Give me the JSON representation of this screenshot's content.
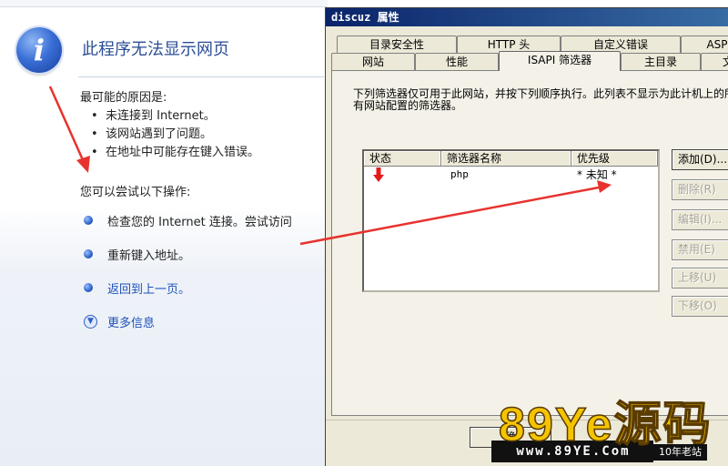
{
  "browser_page": {
    "title": "此程序无法显示网页",
    "causes_heading": "最可能的原因是:",
    "causes": [
      "未连接到 Internet。",
      "该网站遇到了问题。",
      "在地址中可能存在键入错误。"
    ],
    "try_heading": "您可以尝试以下操作:",
    "actions": [
      "检查您的 Internet 连接。尝试访问",
      "重新键入地址。",
      "返回到上一页。",
      "更多信息"
    ]
  },
  "dialog": {
    "title": "discuz 属性",
    "tabs_row1": [
      "目录安全性",
      "HTTP 头",
      "自定义错误",
      "ASP"
    ],
    "tabs_row2": [
      "网站",
      "性能",
      "ISAPI 筛选器",
      "主目录",
      "文"
    ],
    "description": "下列筛选器仅可用于此网站，并按下列顺序执行。此列表不显示为此计机上的所有网站配置的筛选器。",
    "columns": [
      "状态",
      "筛选器名称",
      "优先级"
    ],
    "filters": [
      {
        "name": "php",
        "priority": "* 未知 *"
      }
    ],
    "buttons": {
      "add": "添加(D)...",
      "delete": "删除(R)",
      "edit": "编辑(I)...",
      "disable": "禁用(E)",
      "up": "上移(U)",
      "down": "下移(O)",
      "ok_partial": "确"
    }
  },
  "watermark": {
    "logo_text": "89Ye源码",
    "url": "www.89YE.Com",
    "tag": "10年老站"
  },
  "colors": {
    "accent_blue": "#2a4d96",
    "arrow_red": "#e8322e",
    "watermark_yellow": "#f5c400",
    "dialog_face": "#ece9d8"
  }
}
